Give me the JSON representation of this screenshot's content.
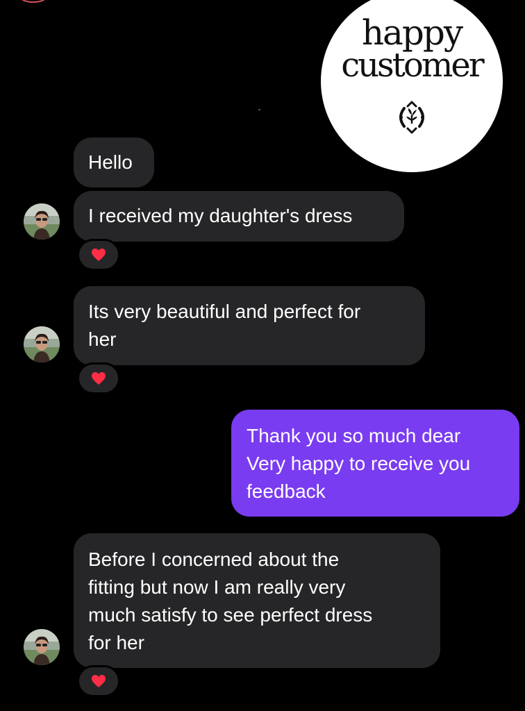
{
  "badge": {
    "line1": "happy",
    "line2": "customer",
    "emblem_icon": "floral-emblem-icon"
  },
  "messages": [
    {
      "sender": "customer",
      "text": "Hello",
      "reaction": null
    },
    {
      "sender": "customer",
      "text": "I received my daughter's dress",
      "reaction": "heart"
    },
    {
      "sender": "customer",
      "text_lines": [
        "Its very beautiful and perfect for",
        "her"
      ],
      "reaction": "heart"
    },
    {
      "sender": "shop",
      "text_lines": [
        "Thank you so much dear",
        "Very happy to receive you",
        "feedback"
      ],
      "reaction": null
    },
    {
      "sender": "customer",
      "text_lines": [
        "Before I concerned about the",
        "fitting but now I am really very",
        "much satisfy to see perfect dress",
        "for her"
      ],
      "reaction": "heart"
    }
  ],
  "colors": {
    "background": "#000000",
    "received_bubble": "#262628",
    "sent_bubble": "#7a3cf0",
    "heart": "#ff2d45",
    "badge": "#ffffff"
  },
  "icons": {
    "avatar": "customer-avatar",
    "reaction": "heart-icon"
  }
}
